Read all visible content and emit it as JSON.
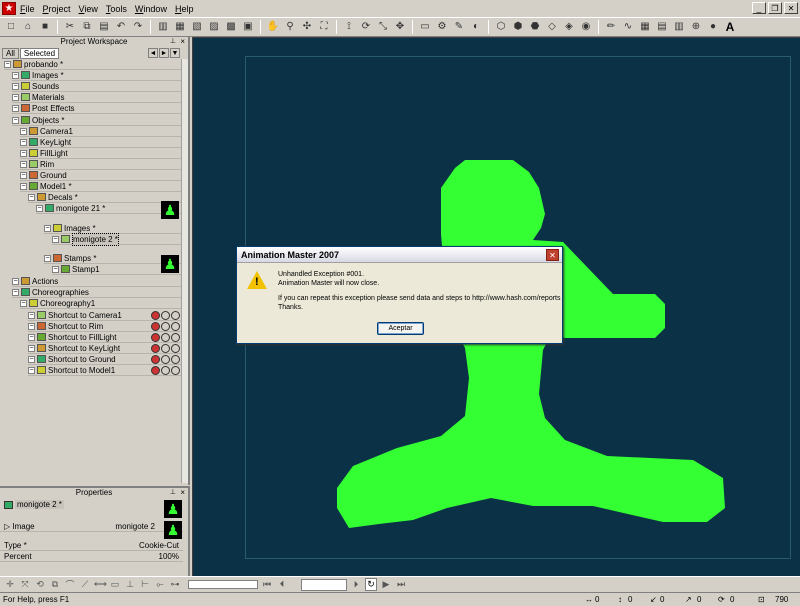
{
  "menu": [
    "File",
    "Project",
    "View",
    "Tools",
    "Window",
    "Help"
  ],
  "workspace": {
    "title": "Project Workspace",
    "tabs": [
      "All",
      "Selected"
    ],
    "tree": [
      {
        "label": "probando *",
        "indent": 0
      },
      {
        "label": "Images *",
        "indent": 1
      },
      {
        "label": "Sounds",
        "indent": 1
      },
      {
        "label": "Materials",
        "indent": 1
      },
      {
        "label": "Post Effects",
        "indent": 1
      },
      {
        "label": "Objects *",
        "indent": 1
      },
      {
        "label": "Camera1",
        "indent": 2
      },
      {
        "label": "KeyLight",
        "indent": 2
      },
      {
        "label": "FillLight",
        "indent": 2
      },
      {
        "label": "Rim",
        "indent": 2
      },
      {
        "label": "Ground",
        "indent": 2
      },
      {
        "label": "Model1 *",
        "indent": 2
      },
      {
        "label": "Decals *",
        "indent": 3
      },
      {
        "label": "monigote 21 *",
        "indent": 4
      },
      {
        "label": "Images *",
        "indent": 5
      },
      {
        "label": "monigote 2 *",
        "indent": 6
      },
      {
        "label": "Stamps *",
        "indent": 5
      },
      {
        "label": "Stamp1",
        "indent": 6
      },
      {
        "label": "Actions",
        "indent": 1
      },
      {
        "label": "Choreographies",
        "indent": 1
      },
      {
        "label": "Choreography1",
        "indent": 2
      },
      {
        "label": "Shortcut to Camera1",
        "indent": 3
      },
      {
        "label": "Shortcut to Rim",
        "indent": 3
      },
      {
        "label": "Shortcut to FillLight",
        "indent": 3
      },
      {
        "label": "Shortcut to KeyLight",
        "indent": 3
      },
      {
        "label": "Shortcut to Ground",
        "indent": 3
      },
      {
        "label": "Shortcut to Model1",
        "indent": 3
      }
    ]
  },
  "properties": {
    "title": "Properties",
    "object": "monigote 2 *",
    "rows": [
      {
        "label": "Image",
        "value": "monigote 2"
      },
      {
        "label": "Type *",
        "value": "Cookie-Cut"
      },
      {
        "label": "Percent",
        "value": "100%"
      }
    ]
  },
  "dialog": {
    "title": "Animation Master 2007",
    "line1": "Unhandled Exception #001.",
    "line2": "Animation Master will now close.",
    "line3": "If you can repeat this exception please send data and steps to http://www.hash.com/reports",
    "line4": "Thanks.",
    "button": "Aceptar"
  },
  "status": {
    "help": "For Help, press F1",
    "v1": "0",
    "v2": "0",
    "v3": "0",
    "v4": "0",
    "v5": "0",
    "zoom": "790"
  },
  "colors": {
    "viewport_bg": "#0b3146",
    "figure": "#33ff33"
  }
}
